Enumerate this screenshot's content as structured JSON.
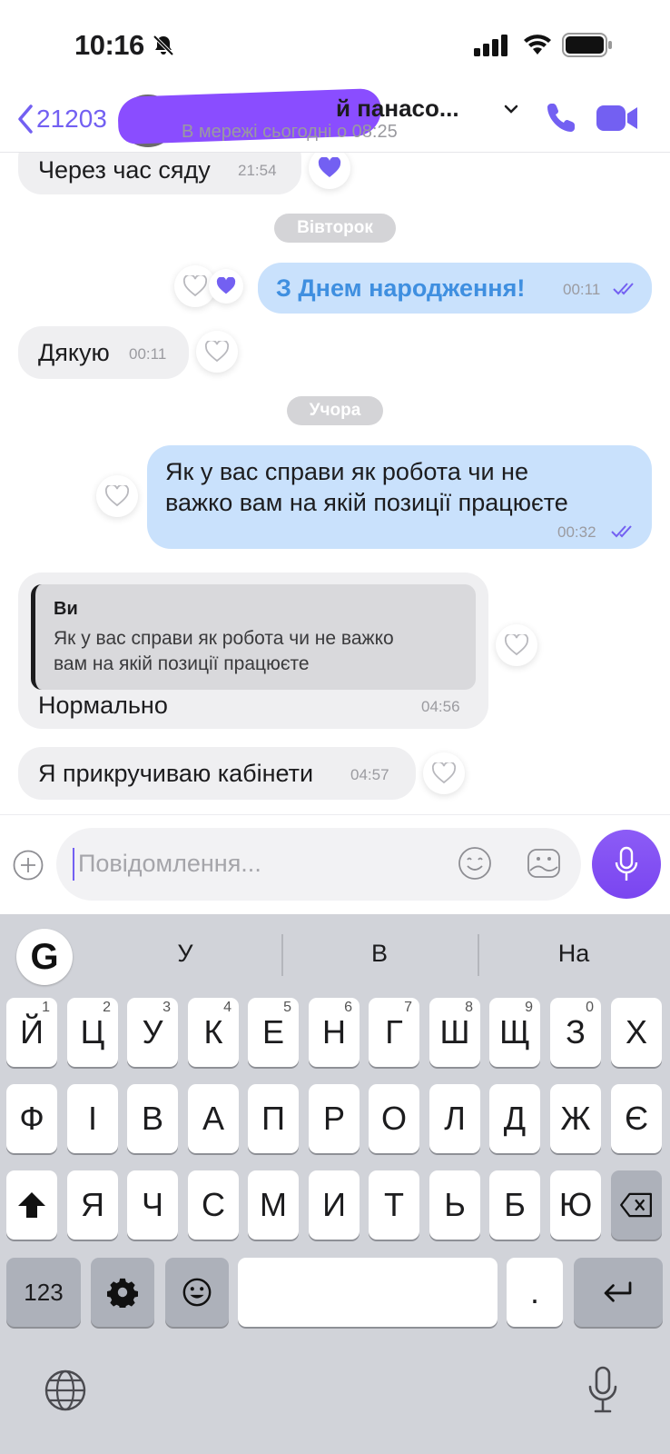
{
  "status_bar": {
    "time": "10:16"
  },
  "header": {
    "back_count": "21203",
    "contact_name": "й панасо...",
    "last_seen": "В мережі сьогодні о 08:25"
  },
  "messages": [
    {
      "direction": "in",
      "text": "Через час сяду",
      "time": "21:54"
    },
    {
      "day_separator": "Вівторок"
    },
    {
      "direction": "out",
      "text": "З Днем народження!",
      "time": "00:11"
    },
    {
      "direction": "in",
      "text": "Дякую",
      "time": "00:11"
    },
    {
      "day_separator": "Учора"
    },
    {
      "direction": "out",
      "text_lines": [
        "Як у вас справи як робота чи не",
        "важко вам на якій позиції працюєте"
      ],
      "time": "00:32"
    },
    {
      "direction": "in",
      "quote_author": "Ви",
      "quote_text": "Як у вас справи як робота чи не важко\nвам на якій позиції працюєте",
      "text": "Нормально",
      "time": "04:56"
    },
    {
      "direction": "in",
      "text": "Я прикручиваю кабінети",
      "time": "04:57"
    }
  ],
  "composer": {
    "placeholder": "Повідомлення..."
  },
  "keyboard": {
    "suggestions": [
      "У",
      "В",
      "На"
    ],
    "row1": [
      "Й",
      "Ц",
      "У",
      "К",
      "Е",
      "Н",
      "Г",
      "Ш",
      "Щ",
      "З",
      "Х"
    ],
    "row1_numbers": [
      "1",
      "2",
      "3",
      "4",
      "5",
      "6",
      "7",
      "8",
      "9",
      "0"
    ],
    "row2": [
      "Ф",
      "І",
      "В",
      "А",
      "П",
      "Р",
      "О",
      "Л",
      "Д",
      "Ж",
      "Є"
    ],
    "row3": [
      "Я",
      "Ч",
      "С",
      "М",
      "И",
      "Т",
      "Ь",
      "Б",
      "Ю"
    ],
    "numbers_key": "123",
    "period_key": "."
  },
  "colors": {
    "accent": "#7360f2",
    "outgoing_bubble": "#c9e1fc",
    "incoming_bubble": "#efeff1"
  }
}
